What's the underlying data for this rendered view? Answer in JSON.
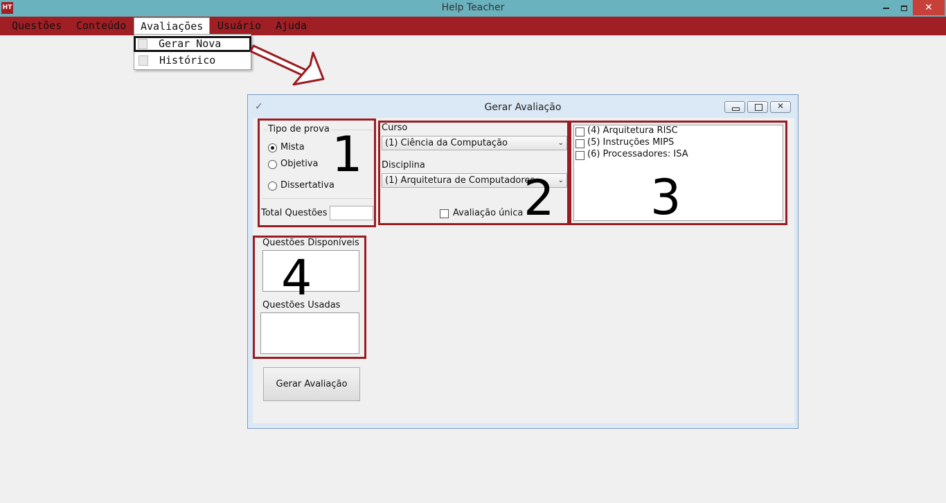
{
  "app": {
    "title": "Help Teacher",
    "icon_text": "HT",
    "close_glyph": "✕"
  },
  "menubar": {
    "items": [
      "Questões",
      "Conteúdo",
      "Avaliações",
      "Usuário",
      "Ajuda"
    ],
    "active": "Avaliações"
  },
  "dropdown": {
    "items": [
      {
        "label": "Gerar Nova",
        "icon": "new-document-icon",
        "selected": true
      },
      {
        "label": "Histórico",
        "icon": "history-document-icon",
        "selected": false
      }
    ]
  },
  "dialog": {
    "title": "Gerar Avaliação",
    "close_glyph": "✕",
    "tipo": {
      "group_label": "Tipo de prova",
      "options": [
        "Mista",
        "Objetiva",
        "Dissertativa"
      ],
      "selected": "Mista",
      "total_label": "Total Questões",
      "total_value": ""
    },
    "curso": {
      "label": "Curso",
      "value": "(1) Ciência da Computação"
    },
    "disciplina": {
      "label": "Disciplina",
      "value": "(1) Arquitetura de Computadores"
    },
    "avaliacao_unica": {
      "label": "Avaliação única",
      "checked": false
    },
    "conteudos": [
      {
        "label": "(4) Arquitetura RISC",
        "checked": false
      },
      {
        "label": "(5) Instruções MIPS",
        "checked": false
      },
      {
        "label": "(6) Processadores: ISA",
        "checked": false
      }
    ],
    "questoes_disponiveis_label": "Questões Disponíveis",
    "questoes_usadas_label": "Questões Usadas",
    "gerar_button": "Gerar Avaliação"
  },
  "annotations": {
    "colors": {
      "frame": "#9a1c22",
      "arrow": "#9a1c22",
      "menubar": "#a01f25",
      "titlebar": "#6ab2bd"
    },
    "numbers": [
      "1",
      "2",
      "3",
      "4"
    ]
  }
}
